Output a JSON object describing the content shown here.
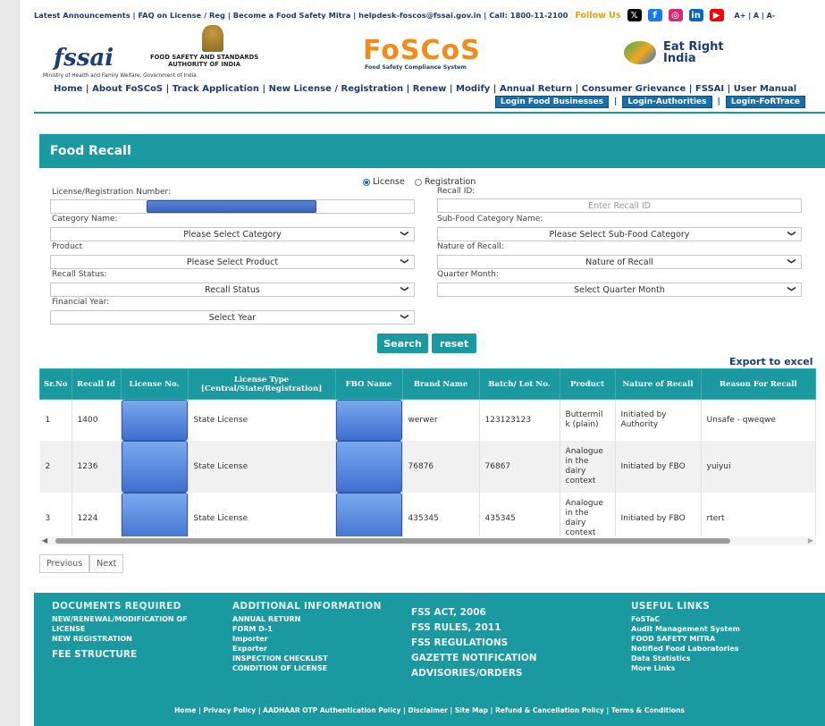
{
  "topbar": {
    "links": "Latest Announcements | FAQ on License / Reg | Become a Food Safety Mitra | helpdesk-foscos@fssai.gov.in | Call: 1800-11-2100",
    "follow": "Follow Us",
    "sizes": "A+ | A | A-",
    "social": [
      {
        "icon": "x-twitter-icon",
        "glyph": "𝕏",
        "color": "#000000"
      },
      {
        "icon": "facebook-icon",
        "glyph": "f",
        "color": "#1877f2"
      },
      {
        "icon": "instagram-icon",
        "glyph": "◎",
        "color": "#d62976"
      },
      {
        "icon": "linkedin-icon",
        "glyph": "in",
        "color": "#0a66c2"
      },
      {
        "icon": "youtube-icon",
        "glyph": "▶",
        "color": "#ff0000"
      }
    ]
  },
  "logos": {
    "fssai": "fssai",
    "fssai_name_1": "FOOD SAFETY AND STANDARDS",
    "fssai_name_2": "AUTHORITY OF INDIA",
    "ministry": "Ministry of Health and Family Welfare, Government of India",
    "foscos": "FoSCoS",
    "foscos_sub": "Food Safety Compliance System",
    "eatright_1": "Eat Right",
    "eatright_2": "India"
  },
  "nav": {
    "items": [
      "Home",
      "About FoSCoS",
      "Track Application",
      "New License / Registration",
      "Renew",
      "Modify",
      "Annual Return",
      "Consumer Grievance",
      "FSSAI",
      "User Manual"
    ]
  },
  "login": {
    "food_businesses": "Login Food Businesses",
    "authorities": "Login-Authorities",
    "fortrace": "Login-FoRTrace"
  },
  "page": {
    "title": "Food Recall"
  },
  "form": {
    "radio_license": "License",
    "radio_registration": "Registration",
    "license_no_label": "License/Registration Number:",
    "recall_id_label": "Recall ID:",
    "recall_id_placeholder": "Enter Recall ID",
    "category_label": "Category Name:",
    "category_value": "Please Select Category",
    "subcategory_label": "Sub-Food Category Name:",
    "subcategory_value": "Please Select Sub-Food Category",
    "product_label": "Product",
    "product_value": "Please Select Product",
    "nature_label": "Nature of Recall:",
    "nature_value": "Nature of Recall",
    "status_label": "Recall Status:",
    "status_value": "Recall Status",
    "quarter_label": "Quarter Month:",
    "quarter_value": "Select Quarter Month",
    "year_label": "Financial Year:",
    "year_value": "Select Year",
    "search": "Search",
    "reset": "reset"
  },
  "export": "Export to excel",
  "table": {
    "headers": [
      "Sr.No",
      "Recall Id",
      "License No.",
      "License Type [Central/State/Registration]",
      "FBO Name",
      "Brand Name",
      "Batch/ Lot No.",
      "Product",
      "Nature of Recall",
      "Reason For Recall"
    ],
    "rows": [
      {
        "sr": "1",
        "recall_id": "1400",
        "license_type": "State License",
        "brand": "werwer",
        "batch": "123123123",
        "product": "Buttermil k (plain)",
        "nature": "Initiated by Authority",
        "reason": "Unsafe - qweqwe"
      },
      {
        "sr": "2",
        "recall_id": "1236",
        "license_type": "State License",
        "brand": "76876",
        "batch": "76867",
        "product": "Analogue in the dairy context",
        "nature": "Initiated by FBO",
        "reason": "yuiyui"
      },
      {
        "sr": "3",
        "recall_id": "1224",
        "license_type": "State License",
        "brand": "435345",
        "batch": "435345",
        "product": "Analogue in the dairy context",
        "nature": "Initiated by FBO",
        "reason": "rtert"
      }
    ]
  },
  "pager": {
    "previous": "Previous",
    "next": "Next"
  },
  "footer": {
    "col1_head": "DOCUMENTS REQUIRED",
    "col1_items": [
      "NEW/RENEWAL/MODIFICATION OF LICENSE",
      "NEW REGISTRATION"
    ],
    "col1_big": "FEE STRUCTURE",
    "col2_head": "ADDITIONAL INFORMATION",
    "col2_items": [
      "ANNUAL RETURN",
      "FORM D-1",
      "Importer",
      "Exporter",
      "INSPECTION CHECKLIST",
      "CONDITION OF LICENSE"
    ],
    "col3_items": [
      "FSS ACT, 2006",
      "FSS RULES, 2011",
      "FSS REGULATIONS",
      "GAZETTE NOTIFICATION",
      "ADVISORIES/ORDERS"
    ],
    "col4_head": "USEFUL LINKS",
    "col4_items": [
      "FoSTaC",
      "Audit Management System",
      "FOOD SAFETY MITRA",
      "Notified Food Laboratories",
      "Data Statistics",
      "More Links"
    ],
    "bottom": "Home | Privacy Policy | AADHAAR OTP Authentication Policy | Disclaimer | Site Map | Refund & Cancellation Policy | Terms & Conditions"
  }
}
